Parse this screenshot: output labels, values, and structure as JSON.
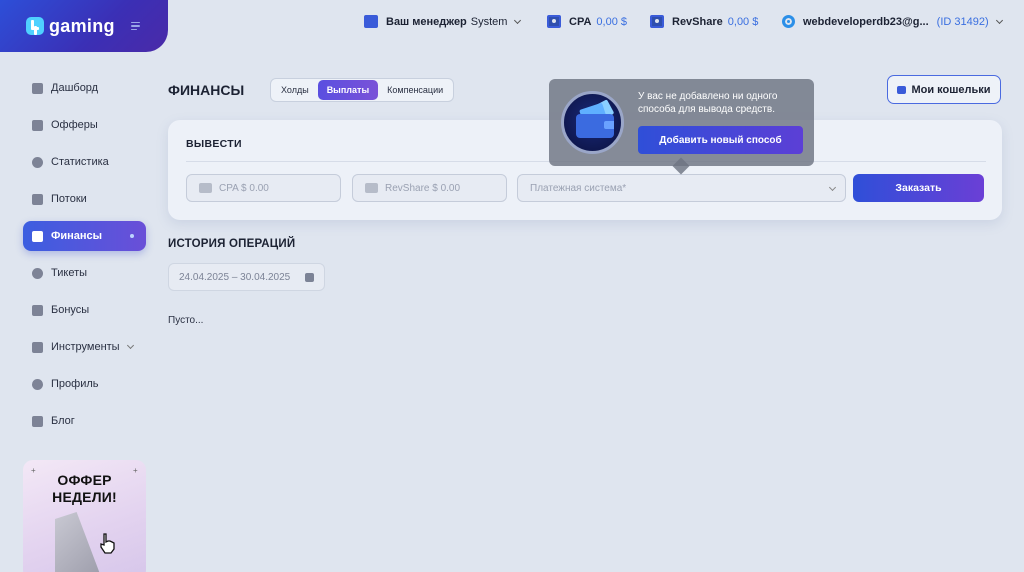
{
  "app": {
    "logo_text": "gaming"
  },
  "topbar": {
    "manager_label": "Ваш менеджер",
    "manager_name": "System",
    "cpa_label": "CPA",
    "cpa_value": "0,00 $",
    "revshare_label": "RevShare",
    "revshare_value": "0,00 $",
    "user_email": "webdeveloperdb23@g...",
    "user_id": "(ID 31492)"
  },
  "sidebar": {
    "items": [
      {
        "label": "Дашборд",
        "icon": "dashboard-icon"
      },
      {
        "label": "Офферы",
        "icon": "offers-icon"
      },
      {
        "label": "Статистика",
        "icon": "statistics-icon"
      },
      {
        "label": "Потоки",
        "icon": "streams-icon"
      },
      {
        "label": "Финансы",
        "icon": "finance-icon",
        "active": true
      },
      {
        "label": "Тикеты",
        "icon": "tickets-icon"
      },
      {
        "label": "Бонусы",
        "icon": "bonus-icon"
      },
      {
        "label": "Инструменты",
        "icon": "tools-icon",
        "has_submenu": true
      },
      {
        "label": "Профиль",
        "icon": "profile-icon"
      },
      {
        "label": "Блог",
        "icon": "blog-icon"
      }
    ],
    "promo": {
      "line1": "ОФФЕР",
      "line2": "НЕДЕЛИ!"
    }
  },
  "main": {
    "title": "ФИНАНСЫ",
    "tabs": [
      {
        "label": "Холды"
      },
      {
        "label": "Выплаты",
        "active": true
      },
      {
        "label": "Компенсации"
      }
    ],
    "wallets_button": "Мои кошельки",
    "withdraw": {
      "title": "ВЫВЕСТИ",
      "cpa_placeholder": "CPA $ 0.00",
      "revshare_placeholder": "RevShare $ 0.00",
      "payment_placeholder": "Платежная система*",
      "order_button": "Заказать"
    },
    "history": {
      "title": "ИСТОРИЯ ОПЕРАЦИЙ",
      "date_range": "24.04.2025 – 30.04.2025",
      "empty_text": "Пусто..."
    }
  },
  "popup": {
    "message": "У вас не добавлено ни одного способа для вывода средств.",
    "button": "Добавить новый способ"
  },
  "colors": {
    "accent": "#3c5ee0",
    "accent2": "#6a4fd8",
    "background": "#dfe5ef",
    "link_blue": "#3a6fe0"
  }
}
